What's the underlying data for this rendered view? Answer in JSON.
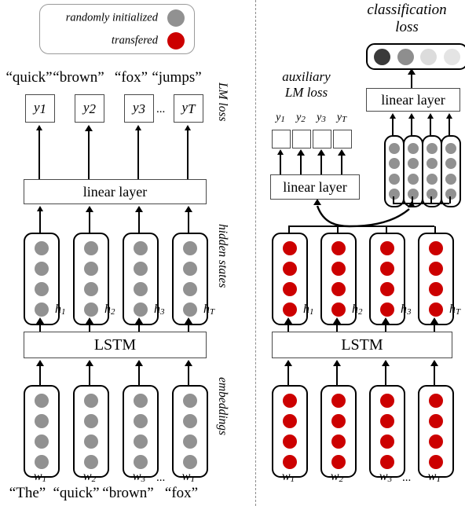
{
  "legend": {
    "rows": [
      {
        "label": "randomly initialized",
        "color": "#919191",
        "icon": "gray-circle"
      },
      {
        "label": "transfered",
        "color": "#CC0000",
        "icon": "red-circle"
      }
    ]
  },
  "colors": {
    "gray": "#919191",
    "red": "#CC0000",
    "cls1": "#3a3a3a",
    "cls2": "#8e8e8e",
    "cls3": "#dcdcdc",
    "cls4": "#e4e4e4",
    "divider": "#8d8d8d"
  },
  "left_panel": {
    "top_words": [
      "“quick”",
      "“brown”",
      "“fox”",
      "“jumps”"
    ],
    "bottom_words": [
      "“The”",
      "“quick”",
      "“brown”",
      "“fox”"
    ],
    "y_labels": [
      "y",
      "y",
      "y",
      "y"
    ],
    "y_subs": [
      "1",
      "2",
      "3",
      "T"
    ],
    "h_labels": [
      "h",
      "h",
      "h",
      "h"
    ],
    "h_subs": [
      "1",
      "2",
      "3",
      "T"
    ],
    "w_labels": [
      "w",
      "w",
      "w",
      "w"
    ],
    "w_subs": [
      "1",
      "2",
      "3",
      "T"
    ],
    "linear_layer": "linear layer",
    "lstm": "LSTM",
    "ellipsis": "...",
    "side_labels": [
      "LM loss",
      "hidden states",
      "embeddings"
    ]
  },
  "right_panel": {
    "classification_title": "classification\nloss",
    "classification_title_line1": "classification",
    "classification_title_line2": "loss",
    "classification_cells": [
      "#3a3a3a",
      "#8e8e8e",
      "#dcdcdc",
      "#e4e4e4"
    ],
    "classification_linear_layer": "linear layer",
    "aux_title_line1": "auxiliary",
    "aux_title_line2": "LM loss",
    "aux_linear_layer": "linear layer",
    "y_labels": [
      "y",
      "y",
      "y",
      "y"
    ],
    "y_subs": [
      "1",
      "2",
      "3",
      "T"
    ],
    "h_labels": [
      "h",
      "h",
      "h",
      "h"
    ],
    "h_subs": [
      "1",
      "2",
      "3",
      "T"
    ],
    "w_labels": [
      "w",
      "w",
      "w",
      "w"
    ],
    "w_subs": [
      "1",
      "2",
      "3",
      "T"
    ],
    "lstm": "LSTM",
    "ellipsis": "..."
  }
}
